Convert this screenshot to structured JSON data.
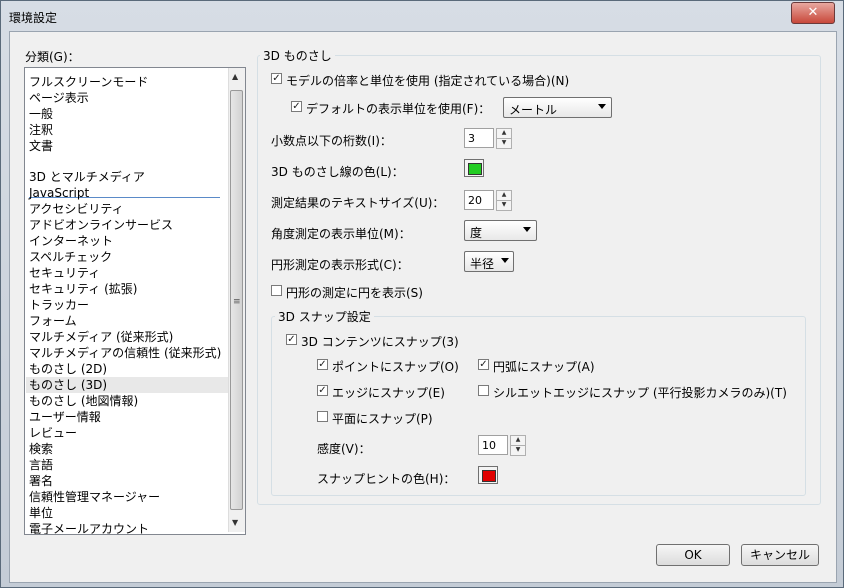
{
  "window": {
    "title": "環境設定",
    "close_glyph": "✕"
  },
  "sidebar": {
    "label": "分類(G)：",
    "top_items": [
      "フルスクリーンモード",
      "ページ表示",
      "一般",
      "注釈",
      "文書"
    ],
    "items": [
      "3D とマルチメディア",
      "JavaScript",
      "アクセシビリティ",
      "アドビオンラインサービス",
      "インターネット",
      "スペルチェック",
      "セキュリティ",
      "セキュリティ (拡張)",
      "トラッカー",
      "フォーム",
      "マルチメディア (従来形式)",
      "マルチメディアの信頼性 (従来形式)",
      "ものさし (2D)",
      "ものさし (3D)",
      "ものさし (地図情報)",
      "ユーザー情報",
      "レビュー",
      "検索",
      "言語",
      "署名",
      "信頼性管理マネージャー",
      "単位",
      "電子メールアカウント"
    ],
    "selected": "ものさし (3D)",
    "scroll_up_icon": "scroll-up-arrow",
    "scroll_down_icon": "scroll-down-arrow"
  },
  "panel": {
    "group_title": "3D ものさし",
    "use_model_scale": {
      "label": "モデルの倍率と単位を使用 (指定されている場合)(N)",
      "checked": true
    },
    "use_default_units": {
      "label": "デフォルトの表示単位を使用(F)：",
      "checked": true,
      "value": "メートル"
    },
    "decimal_places": {
      "label": "小数点以下の桁数(I)：",
      "value": "3"
    },
    "line_color": {
      "label": "3D ものさし線の色(L)：",
      "color": "#22cc22"
    },
    "text_size": {
      "label": "測定結果のテキストサイズ(U)：",
      "value": "20"
    },
    "angle_units": {
      "label": "角度測定の表示単位(M)：",
      "value": "度"
    },
    "circle_format": {
      "label": "円形測定の表示形式(C)：",
      "value": "半径"
    },
    "show_circle": {
      "label": "円形の測定に円を表示(S)",
      "checked": false
    },
    "snap": {
      "title": "3D スナップ設定",
      "snap_3d": {
        "label": "3D コンテンツにスナップ(3)",
        "checked": true
      },
      "snap_point": {
        "label": "ポイントにスナップ(O)",
        "checked": true
      },
      "snap_arc": {
        "label": "円弧にスナップ(A)",
        "checked": true
      },
      "snap_edge": {
        "label": "エッジにスナップ(E)",
        "checked": true
      },
      "snap_silhouette": {
        "label": "シルエットエッジにスナップ (平行投影カメラのみ)(T)",
        "checked": false
      },
      "snap_plane": {
        "label": "平面にスナップ(P)",
        "checked": false
      },
      "sensitivity": {
        "label": "感度(V)：",
        "value": "10"
      },
      "hint_color": {
        "label": "スナップヒントの色(H)：",
        "color": "#e00000"
      }
    }
  },
  "buttons": {
    "ok": "OK",
    "cancel": "キャンセル"
  }
}
